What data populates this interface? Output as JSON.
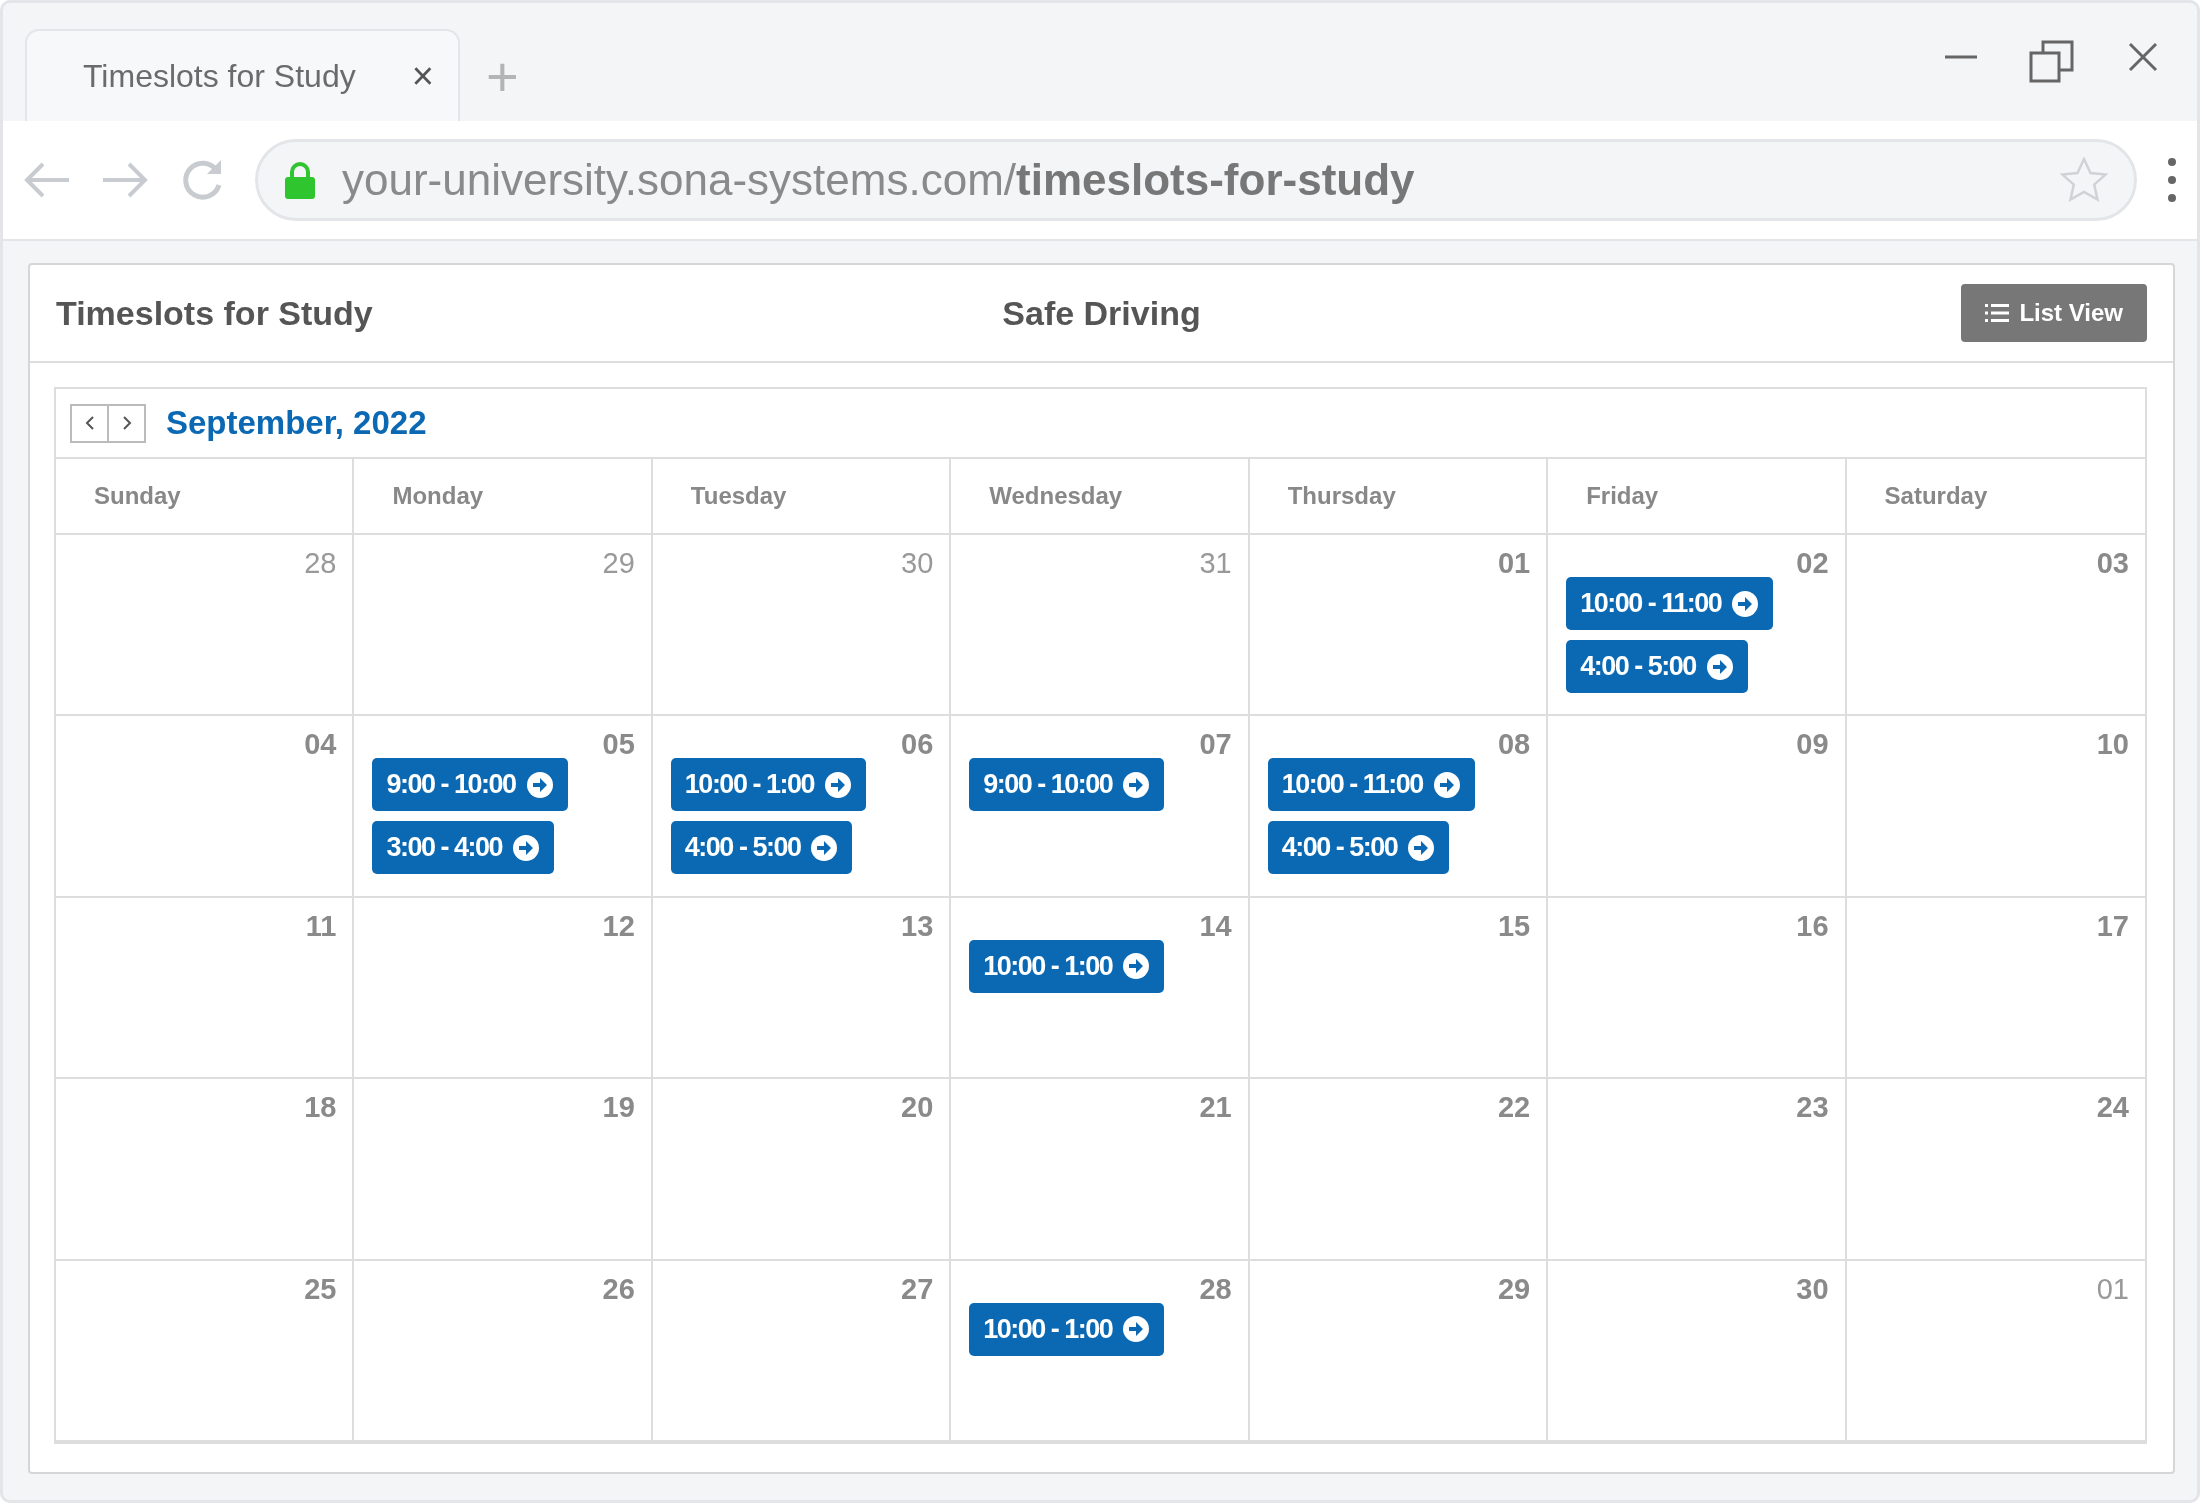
{
  "browser": {
    "tab_title": "Timeslots for Study",
    "tab_close": "×",
    "new_tab": "+",
    "url_host": "your-university.sona-systems.com/",
    "url_path": "timeslots-for-study"
  },
  "header": {
    "title": "Timeslots for Study",
    "study": "Safe Driving",
    "list_view_button": "List View"
  },
  "calendar": {
    "month": "September, 2022",
    "weekdays": [
      "Sunday",
      "Monday",
      "Tuesday",
      "Wednesday",
      "Thursday",
      "Friday",
      "Saturday"
    ],
    "weeks": [
      [
        {
          "date": "28",
          "other_month": true
        },
        {
          "date": "29",
          "other_month": true
        },
        {
          "date": "30",
          "other_month": true
        },
        {
          "date": "31",
          "other_month": true
        },
        {
          "date": "01",
          "other_month": false
        },
        {
          "date": "02",
          "other_month": false,
          "slots": [
            "10:00 - 11:00",
            "4:00 - 5:00"
          ]
        },
        {
          "date": "03",
          "other_month": false
        }
      ],
      [
        {
          "date": "04",
          "other_month": false
        },
        {
          "date": "05",
          "other_month": false,
          "slots": [
            "9:00 - 10:00",
            "3:00 - 4:00"
          ]
        },
        {
          "date": "06",
          "other_month": false,
          "slots": [
            "10:00 - 1:00",
            "4:00 - 5:00"
          ]
        },
        {
          "date": "07",
          "other_month": false,
          "slots": [
            "9:00 - 10:00"
          ]
        },
        {
          "date": "08",
          "other_month": false,
          "slots": [
            "10:00 - 11:00",
            "4:00 - 5:00"
          ]
        },
        {
          "date": "09",
          "other_month": false
        },
        {
          "date": "10",
          "other_month": false
        }
      ],
      [
        {
          "date": "11",
          "other_month": false
        },
        {
          "date": "12",
          "other_month": false
        },
        {
          "date": "13",
          "other_month": false
        },
        {
          "date": "14",
          "other_month": false,
          "slots": [
            "10:00 - 1:00"
          ]
        },
        {
          "date": "15",
          "other_month": false
        },
        {
          "date": "16",
          "other_month": false
        },
        {
          "date": "17",
          "other_month": false
        }
      ],
      [
        {
          "date": "18",
          "other_month": false
        },
        {
          "date": "19",
          "other_month": false
        },
        {
          "date": "20",
          "other_month": false
        },
        {
          "date": "21",
          "other_month": false
        },
        {
          "date": "22",
          "other_month": false
        },
        {
          "date": "23",
          "other_month": false
        },
        {
          "date": "24",
          "other_month": false
        }
      ],
      [
        {
          "date": "25",
          "other_month": false
        },
        {
          "date": "26",
          "other_month": false
        },
        {
          "date": "27",
          "other_month": false
        },
        {
          "date": "28",
          "other_month": false,
          "slots": [
            "10:00 - 1:00"
          ]
        },
        {
          "date": "29",
          "other_month": false
        },
        {
          "date": "30",
          "other_month": false
        },
        {
          "date": "01",
          "other_month": true
        }
      ]
    ]
  }
}
